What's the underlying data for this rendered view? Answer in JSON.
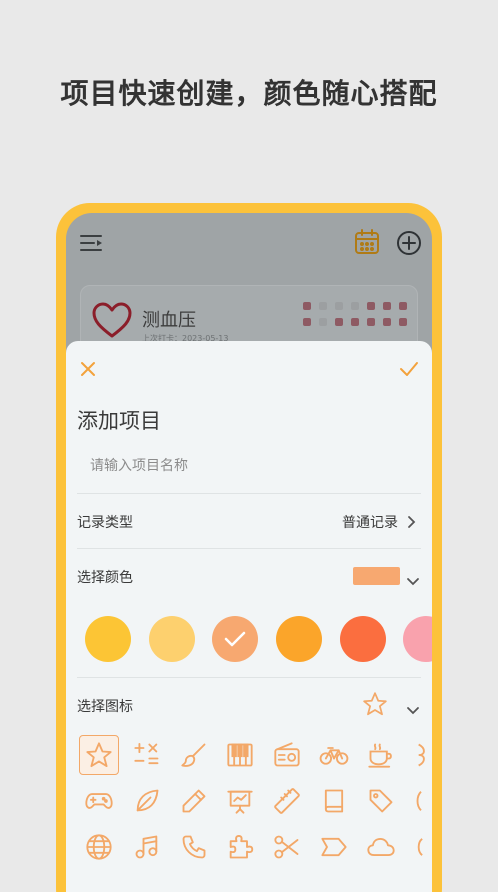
{
  "headline": "项目快速创建，颜色随心搭配",
  "topbar": {
    "menu_icon": "menu-icon",
    "calendar_icon": "calendar-icon",
    "add_icon": "plus-circle-icon"
  },
  "card": {
    "title": "测血压",
    "subtitle": "上次打卡：2023-05-13",
    "icon": "heart-icon"
  },
  "sheet": {
    "title": "添加项目",
    "name_placeholder": "请输入项目名称",
    "name_value": "",
    "record_type_label": "记录类型",
    "record_type_value": "普通记录",
    "color_label": "选择颜色",
    "icon_label": "选择图标"
  },
  "colors": {
    "accent": "#f3a868",
    "selected_color": "#f7a870",
    "palette": [
      "#fcc535",
      "#fdd06e",
      "#f7a870",
      "#fba52a",
      "#fb6e3f",
      "#f9a2ad"
    ],
    "selected_index": 2
  },
  "icons": [
    "star-icon",
    "calculator-icon",
    "brush-icon",
    "piano-icon",
    "radio-icon",
    "bicycle-icon",
    "coffee-icon",
    "gamepad-icon",
    "leaf-icon",
    "pencil-icon",
    "presentation-icon",
    "ruler-icon",
    "book-icon",
    "tag-icon",
    "globe-icon",
    "music-icon",
    "phone-icon",
    "puzzle-icon",
    "scissors-icon",
    "label-icon",
    "cloud-icon"
  ]
}
